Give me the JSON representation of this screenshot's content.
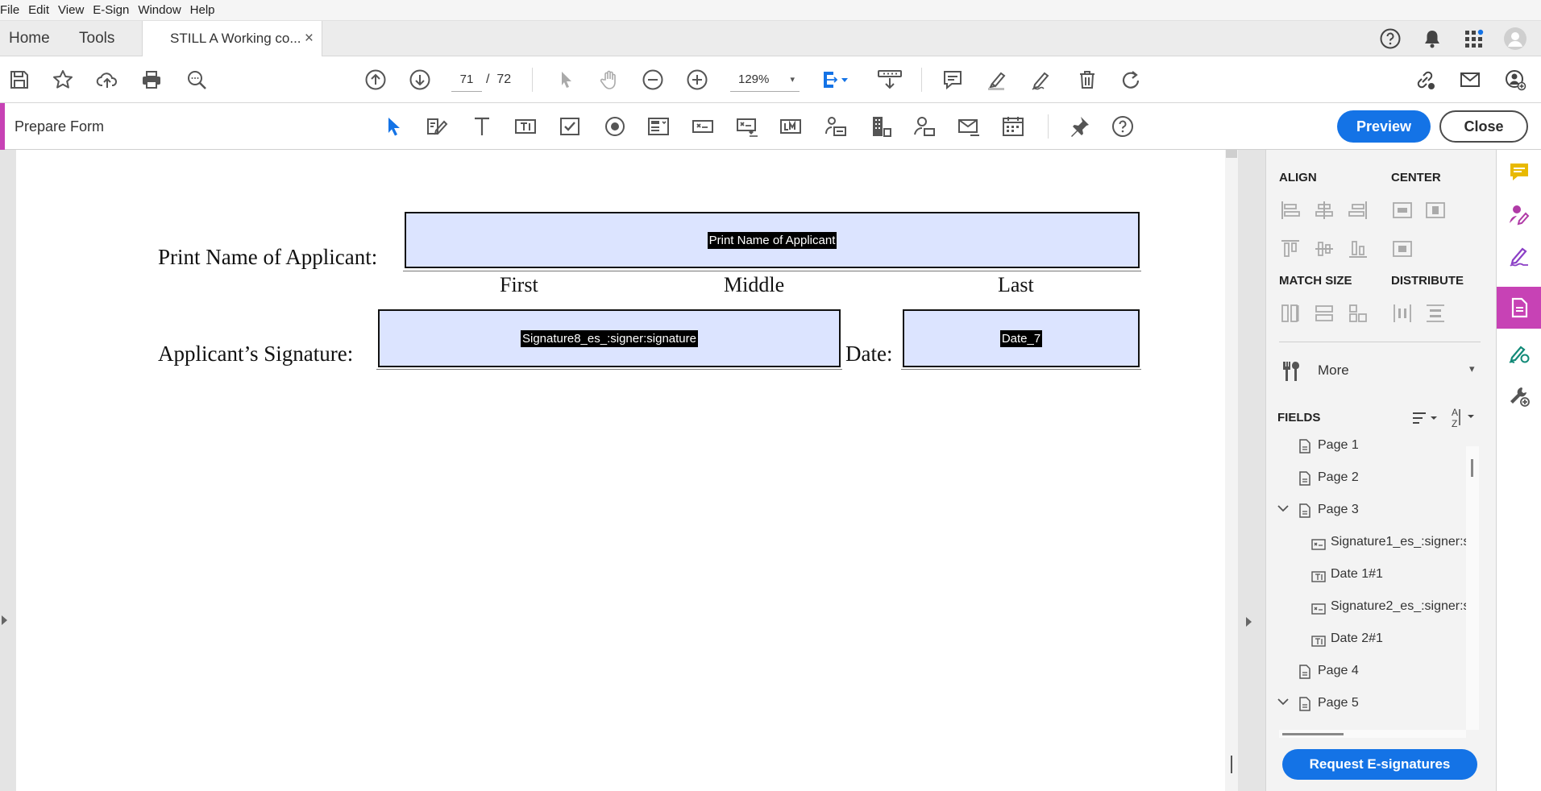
{
  "menu": [
    "File",
    "Edit",
    "View",
    "E-Sign",
    "Window",
    "Help"
  ],
  "tabs": {
    "home": "Home",
    "tools": "Tools",
    "document": "STILL A Working co...",
    "close_glyph": "×"
  },
  "toolbar": {
    "current_page": "71",
    "page_separator": "/",
    "total_pages": "72",
    "zoom": "129%",
    "zoom_caret": "▾"
  },
  "prepare_form": {
    "title": "Prepare Form",
    "preview_label": "Preview",
    "close_label": "Close"
  },
  "document": {
    "print_name_label": "Print Name of Applicant:",
    "print_name_field": "Print Name of Applicant",
    "sub_first": "First",
    "sub_middle": "Middle",
    "sub_last": "Last",
    "signature_label": "Applicant’s Signature:",
    "signature_field": "Signature8_es_:signer:signature",
    "date_label": "Date:",
    "date_field": "Date_7"
  },
  "right_panel": {
    "align": "ALIGN",
    "center": "CENTER",
    "match_size": "MATCH SIZE",
    "distribute": "DISTRIBUTE",
    "more": "More",
    "more_caret": "▾",
    "fields": "FIELDS",
    "tree": [
      {
        "label": "Page 1",
        "kind": "page",
        "level": 0,
        "expanded": false
      },
      {
        "label": "Page 2",
        "kind": "page",
        "level": 0,
        "expanded": false
      },
      {
        "label": "Page 3",
        "kind": "page",
        "level": 0,
        "expanded": true
      },
      {
        "label": "Signature1_es_:signer:s",
        "kind": "signature",
        "level": 1
      },
      {
        "label": "Date 1#1",
        "kind": "text",
        "level": 1
      },
      {
        "label": "Signature2_es_:signer:s",
        "kind": "signature",
        "level": 1
      },
      {
        "label": "Date 2#1",
        "kind": "text",
        "level": 1
      },
      {
        "label": "Page 4",
        "kind": "page",
        "level": 0,
        "expanded": false
      },
      {
        "label": "Page 5",
        "kind": "page",
        "level": 0,
        "expanded": true
      }
    ],
    "request_label": "Request E-signatures"
  },
  "colors": {
    "accent_blue": "#1473e6",
    "prepare_form_magenta": "#c742b5",
    "field_fill": "#dce4ff",
    "comment_yellow": "#e8b900"
  }
}
